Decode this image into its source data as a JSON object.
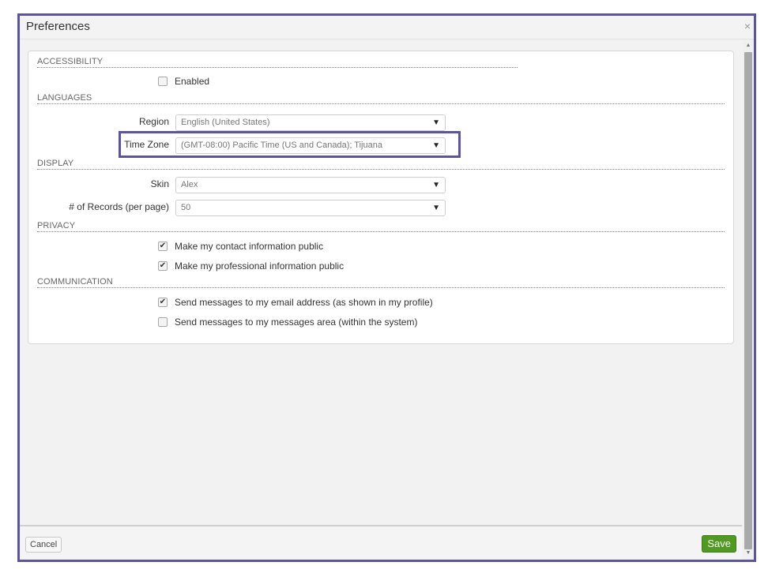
{
  "dialog": {
    "title": "Preferences",
    "close_glyph": "×"
  },
  "sections": {
    "accessibility": "ACCESSIBILITY",
    "languages": "LANGUAGES",
    "display": "DISPLAY",
    "privacy": "PRIVACY",
    "communication": "COMMUNICATION"
  },
  "accessibility": {
    "enabled": {
      "label": "Enabled",
      "checked": false
    }
  },
  "languages": {
    "region": {
      "label": "Region",
      "value": "English (United States)"
    },
    "time_zone": {
      "label": "Time Zone",
      "value": "(GMT-08:00) Pacific Time (US and Canada); Tijuana"
    }
  },
  "display": {
    "skin": {
      "label": "Skin",
      "value": "Alex"
    },
    "records": {
      "label": "# of Records (per page)",
      "value": "50"
    }
  },
  "privacy": {
    "contact": {
      "label": "Make my contact information public",
      "checked": true
    },
    "professional": {
      "label": "Make my professional information public",
      "checked": true
    }
  },
  "communication": {
    "email": {
      "label": "Send messages to my email address (as shown in my profile)",
      "checked": true
    },
    "messages_area": {
      "label": "Send messages to my messages area (within the system)",
      "checked": false
    }
  },
  "footer": {
    "cancel_label": "Cancel",
    "save_label": "Save"
  },
  "icons": {
    "dropdown_arrow": "▼",
    "checkmark": "✔",
    "scroll_up": "▲",
    "scroll_down": "▼"
  },
  "colors": {
    "highlight": "#5b54a4",
    "save_button": "#4f9a1f"
  }
}
